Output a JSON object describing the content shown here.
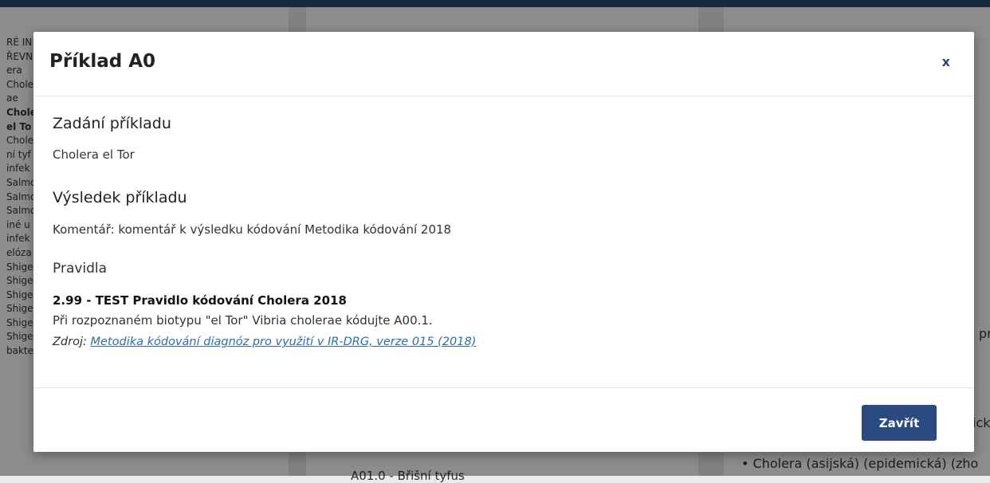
{
  "background": {
    "left_panel": {
      "lines": [
        {
          "text": "RÉ IN",
          "bold": false
        },
        {
          "text": "",
          "bold": false
        },
        {
          "text": "ŘEVNÍ",
          "bold": false
        },
        {
          "text": "era",
          "bold": false
        },
        {
          "text": "Chole",
          "bold": false
        },
        {
          "text": "ae",
          "bold": false
        },
        {
          "text": "Chole",
          "bold": true
        },
        {
          "text": " el To",
          "bold": true
        },
        {
          "text": "Chole",
          "bold": false
        },
        {
          "text": "ní tyf",
          "bold": false
        },
        {
          "text": "infek",
          "bold": false
        },
        {
          "text": "Salmo",
          "bold": false
        },
        {
          "text": "Salmo",
          "bold": false
        },
        {
          "text": "Salmo",
          "bold": false
        },
        {
          "text": "iné u",
          "bold": false
        },
        {
          "text": "infek",
          "bold": false
        },
        {
          "text": "elóza",
          "bold": false
        },
        {
          "text": "Shige",
          "bold": false
        },
        {
          "text": "Shige",
          "bold": false
        },
        {
          "text": "Shige",
          "bold": false
        },
        {
          "text": "Shige",
          "bold": false
        },
        {
          "text": "Shige",
          "bold": false
        },
        {
          "text": "Shige",
          "bold": false
        },
        {
          "text": " bakteriální střevní infekce",
          "bold": false
        }
      ]
    },
    "middle_panel": {
      "item": "A01.0 - Břišní tyfus"
    },
    "right_panel": {
      "fragment_pr": "pr",
      "fragment_ick": "ick",
      "bullet": "• Cholera (asijská) (epidemická) (zho"
    }
  },
  "modal": {
    "title": "Příklad A0",
    "close_glyph": "x",
    "assignment_heading": "Zadání příkladu",
    "assignment_text": "Cholera el Tor",
    "result_heading": "Výsledek příkladu",
    "comment": "Komentář: komentář k výsledku kódování Metodika kódování 2018",
    "rules_heading": "Pravidla",
    "rule_title": "2.99 - TEST Pravidlo kódování Cholera 2018",
    "rule_text": "Při rozpoznaném biotypu \"el Tor\" Vibria cholerae kódujte A00.1.",
    "source_label": "Zdroj: ",
    "source_link": "Metodika kódování diagnóz pro využití v IR-DRG, verze 015 (2018)",
    "footer_button": "Zavřít"
  },
  "colors": {
    "primary": "#2b4a7f",
    "link": "#2d6da8",
    "topbar": "#2b4a6f"
  },
  "icons": {
    "close": "close-icon"
  }
}
